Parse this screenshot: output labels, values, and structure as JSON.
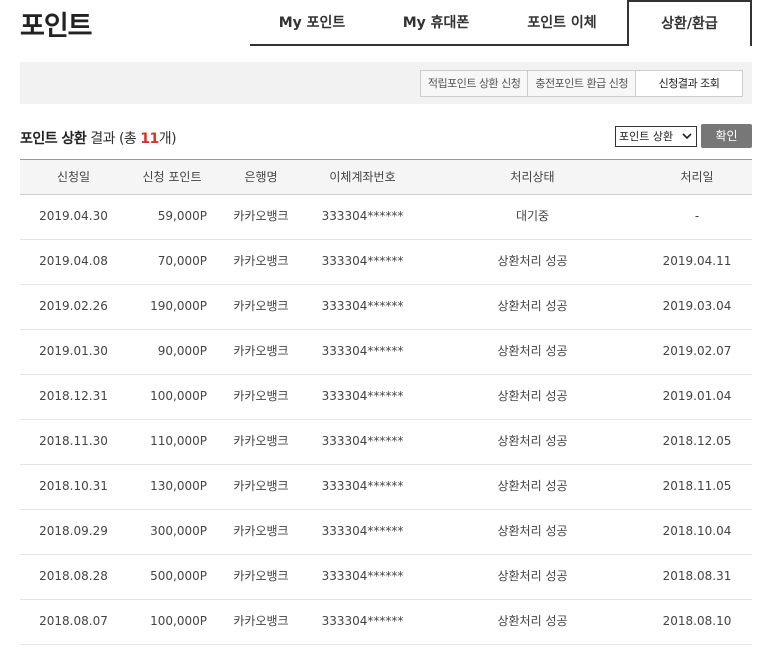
{
  "page": {
    "title": "포인트"
  },
  "tabs": [
    {
      "label": "My 포인트"
    },
    {
      "label": "My 휴대폰"
    },
    {
      "label": "포인트 이체"
    },
    {
      "label": "상환/환급"
    }
  ],
  "subnav": [
    {
      "label": "적립포인트 상환 신청"
    },
    {
      "label": "충전포인트 환급 신청"
    },
    {
      "label": "신청결과 조회"
    }
  ],
  "result": {
    "title_strong": "포인트 상환",
    "title_rest": " 결과 (총 ",
    "count": "11",
    "suffix": "개)"
  },
  "filter": {
    "selected": "포인트 상환",
    "confirm_label": "확인"
  },
  "table": {
    "headers": [
      "신청일",
      "신청 포인트",
      "은행명",
      "이체계좌번호",
      "처리상태",
      "처리일"
    ],
    "rows": [
      [
        "2019.04.30",
        "59,000P",
        "카카오뱅크",
        "333304******",
        "대기중",
        "-"
      ],
      [
        "2019.04.08",
        "70,000P",
        "카카오뱅크",
        "333304******",
        "상환처리 성공",
        "2019.04.11"
      ],
      [
        "2019.02.26",
        "190,000P",
        "카카오뱅크",
        "333304******",
        "상환처리 성공",
        "2019.03.04"
      ],
      [
        "2019.01.30",
        "90,000P",
        "카카오뱅크",
        "333304******",
        "상환처리 성공",
        "2019.02.07"
      ],
      [
        "2018.12.31",
        "100,000P",
        "카카오뱅크",
        "333304******",
        "상환처리 성공",
        "2019.01.04"
      ],
      [
        "2018.11.30",
        "110,000P",
        "카카오뱅크",
        "333304******",
        "상환처리 성공",
        "2018.12.05"
      ],
      [
        "2018.10.31",
        "130,000P",
        "카카오뱅크",
        "333304******",
        "상환처리 성공",
        "2018.11.05"
      ],
      [
        "2018.09.29",
        "300,000P",
        "카카오뱅크",
        "333304******",
        "상환처리 성공",
        "2018.10.04"
      ],
      [
        "2018.08.28",
        "500,000P",
        "카카오뱅크",
        "333304******",
        "상환처리 성공",
        "2018.08.31"
      ],
      [
        "2018.08.07",
        "100,000P",
        "카카오뱅크",
        "333304******",
        "상환처리 성공",
        "2018.08.10"
      ]
    ]
  }
}
